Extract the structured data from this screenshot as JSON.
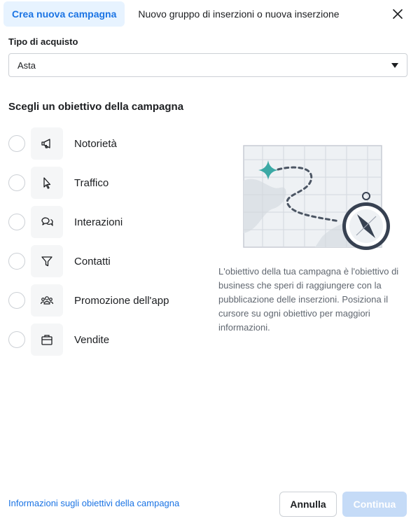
{
  "header": {
    "tabs": [
      {
        "label": "Crea nuova campagna",
        "active": true
      },
      {
        "label": "Nuovo gruppo di inserzioni o nuova inserzione",
        "active": false
      }
    ],
    "close_icon": "close-icon"
  },
  "buying_type": {
    "label": "Tipo di acquisto",
    "selected": "Asta"
  },
  "objectives": {
    "title": "Scegli un obiettivo della campagna",
    "items": [
      {
        "label": "Notorietà",
        "icon": "megaphone-icon",
        "selected": false
      },
      {
        "label": "Traffico",
        "icon": "cursor-icon",
        "selected": false
      },
      {
        "label": "Interazioni",
        "icon": "chat-bubbles-icon",
        "selected": false
      },
      {
        "label": "Contatti",
        "icon": "filter-icon",
        "selected": false
      },
      {
        "label": "Promozione dell'app",
        "icon": "people-icon",
        "selected": false
      },
      {
        "label": "Vendite",
        "icon": "shopping-bag-icon",
        "selected": false
      }
    ]
  },
  "info_panel": {
    "description": "L'obiettivo della tua campagna è l'obiettivo di business che speri di raggiungere con la pubblicazione delle inserzioni. Posiziona il cursore su ogni obiettivo per maggiori informazioni.",
    "illustration": "map-compass-illustration"
  },
  "footer": {
    "link": "Informazioni sugli obiettivi della campagna",
    "cancel_label": "Annulla",
    "continue_label": "Continua"
  },
  "colors": {
    "accent": "#1b74e4",
    "active_tab_bg": "#e7f3ff",
    "disabled_button": "#c5dbf7",
    "illustration_teal": "#3ba9a5"
  }
}
